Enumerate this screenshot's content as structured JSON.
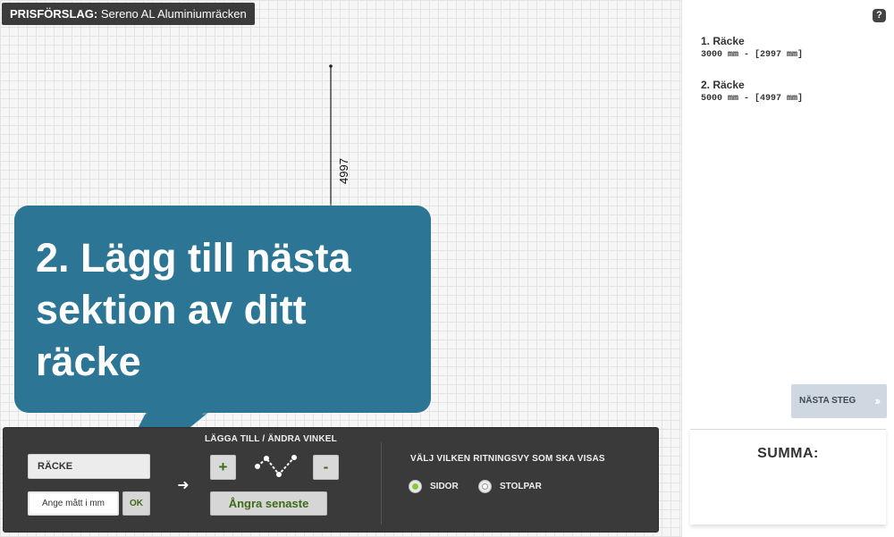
{
  "header": {
    "prefix": "PRISFÖRSLAG:",
    "product": "Sereno AL Aluminiumräcken"
  },
  "drawing": {
    "dimension_label": "4997"
  },
  "callout": {
    "text": "2. Lägg till nästa sektion av ditt räcke"
  },
  "toolbar": {
    "type_button": "RÄCKE",
    "measure_placeholder": "Ange mått i mm",
    "ok_label": "OK",
    "add_angle_heading": "LÄGGA TILL / ÄNDRA VINKEL",
    "plus_label": "+",
    "minus_label": "-",
    "undo_label": "Ångra senaste",
    "view_heading": "VÄLJ VILKEN RITNINGSVY SOM SKA VISAS",
    "view_options": [
      {
        "label": "SIDOR",
        "selected": true
      },
      {
        "label": "STOLPAR",
        "selected": false
      }
    ]
  },
  "sidebar": {
    "help_label": "?",
    "items": [
      {
        "name": "1. Räcke",
        "dims": "3000 mm - [2997 mm]"
      },
      {
        "name": "2. Räcke",
        "dims": "5000 mm - [4997 mm]"
      }
    ],
    "next_label": "NÄSTA STEG",
    "next_chevron": "››",
    "sum_label": "SUMMA:"
  },
  "colors": {
    "callout": "#2d7595",
    "toolbar": "#3a3a3a",
    "accent_green": "#3d6b16",
    "radio_selected": "#8cc63f"
  }
}
